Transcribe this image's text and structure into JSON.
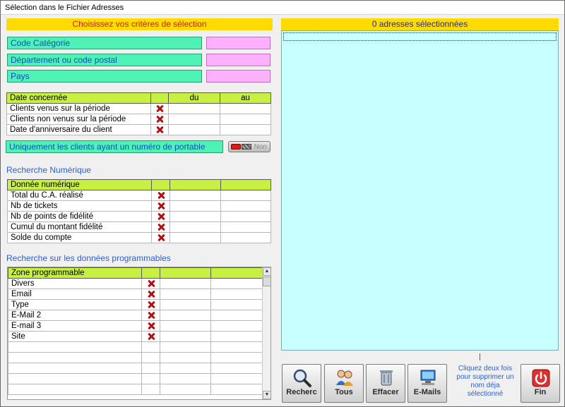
{
  "window": {
    "title": "Sélection dans le Fichier Adresses"
  },
  "criteria": {
    "header": "Choisissez vos critères de sélection",
    "fields": [
      {
        "label": "Code Catégorie",
        "value": ""
      },
      {
        "label": "Département ou code postal",
        "value": ""
      },
      {
        "label": "Pays",
        "value": ""
      }
    ]
  },
  "date_table": {
    "headers": [
      "Date concernée",
      "",
      "du",
      "au"
    ],
    "rows": [
      {
        "label": "Clients venus sur la période"
      },
      {
        "label": "Clients non venus sur la période"
      },
      {
        "label": "Date d'anniversaire du client"
      }
    ]
  },
  "mobile_filter": {
    "label": "Uniquement les clients ayant un numéro de portable",
    "toggle": "Non"
  },
  "numeric": {
    "section_title": "Recherche Numérique",
    "headers": [
      "Donnée numérique",
      "",
      "",
      ""
    ],
    "rows": [
      {
        "label": "Total du C.A. réalisé"
      },
      {
        "label": "Nb de tickets"
      },
      {
        "label": "Nb de points de fidélité"
      },
      {
        "label": "Cumul du montant fidélité"
      },
      {
        "label": "Solde du compte"
      }
    ]
  },
  "programmable": {
    "section_title": "Recherche sur les données programmables",
    "headers": [
      "Zone programmable",
      "",
      "",
      ""
    ],
    "rows": [
      {
        "label": "Divers"
      },
      {
        "label": "Email"
      },
      {
        "label": "Type"
      },
      {
        "label": "E-Mail 2"
      },
      {
        "label": "E-mail 3"
      },
      {
        "label": "Site"
      }
    ],
    "empty_rows": 5
  },
  "results": {
    "header": "0 adresses sélectionnées"
  },
  "hint": {
    "text": "Cliquez deux fois pour supprimer un nom déja sélectionné"
  },
  "buttons": {
    "search": "Recherc",
    "all": "Tous",
    "clear": "Effacer",
    "emails": "E-Mails",
    "end": "Fin"
  },
  "colors": {
    "accent_yellow": "#ffdb00",
    "field_green": "#4ef2b4",
    "header_green": "#c8f040",
    "results_bg": "#c8ffff"
  }
}
